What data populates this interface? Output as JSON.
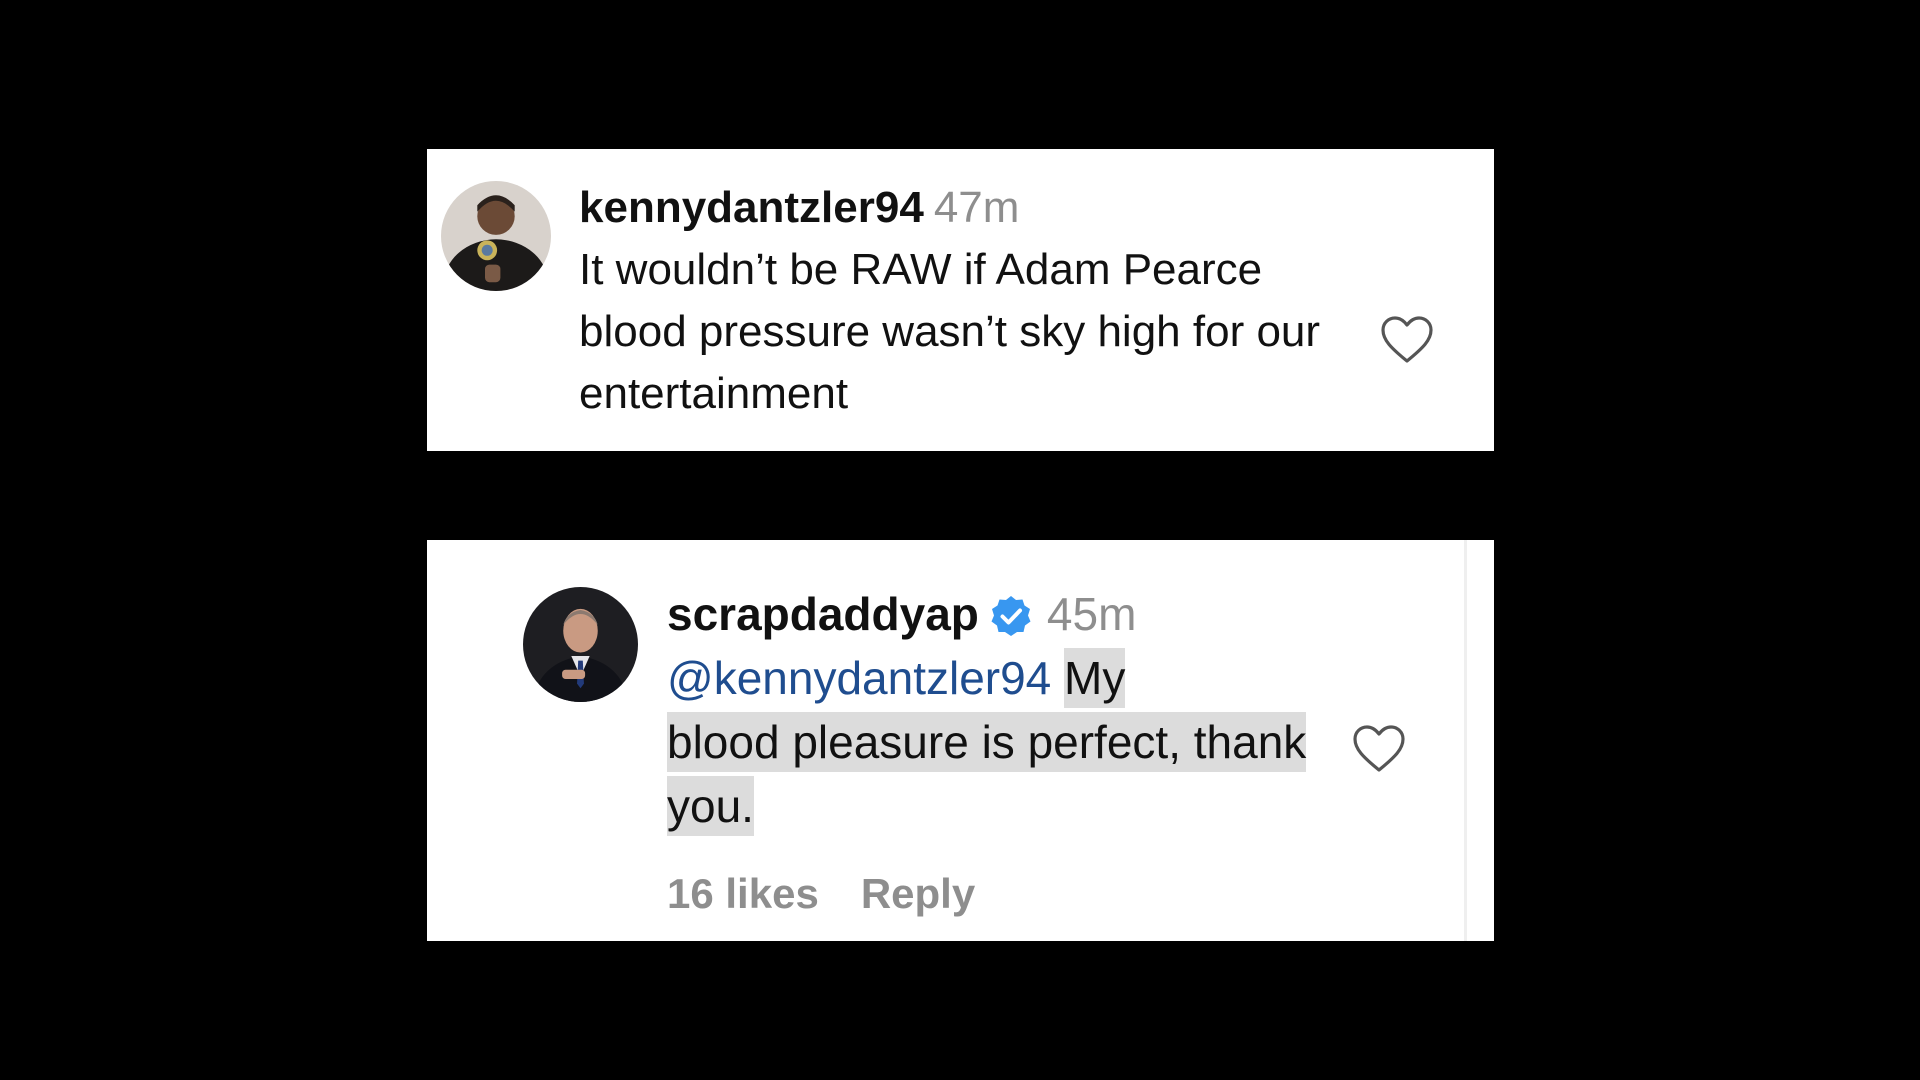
{
  "comments": [
    {
      "username": "kennydantzler94",
      "time": "47m",
      "text": "It wouldn’t be RAW if Adam Pearce blood pressure wasn’t sky high for our entertainment",
      "avatar_icon": "profile-photo-icon",
      "like_icon": "heart-outline-icon"
    },
    {
      "username": "scrapdaddyap",
      "verified_icon": "verified-badge-icon",
      "verified_color": "#3897f0",
      "time": "45m",
      "mention": "@kennydantzler94",
      "text_first": "My",
      "text_rest": "blood pleasure is perfect, thank you.",
      "avatar_icon": "profile-photo-icon",
      "like_icon": "heart-outline-icon",
      "likes": "16 likes",
      "reply_label": "Reply"
    }
  ],
  "colors": {
    "background": "#000000",
    "card": "#ffffff",
    "secondary_text": "#8e8e8e",
    "mention": "#1f4d8f",
    "highlight": "#dcdcdc"
  }
}
